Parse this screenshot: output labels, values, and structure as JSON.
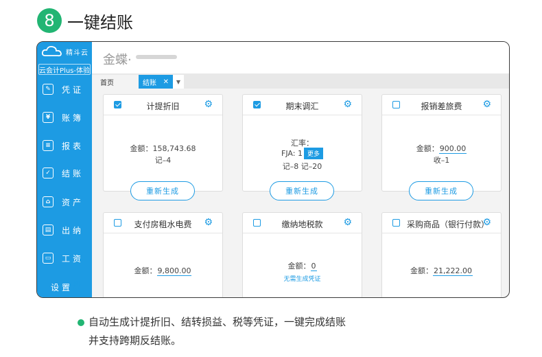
{
  "step": {
    "number": "8",
    "title": "一键结账"
  },
  "sidebar": {
    "logo_text": "精斗云",
    "plan": "云会计Plus-体验",
    "items": [
      {
        "label": "凭证",
        "icon": "voucher-icon",
        "glyph": "✎"
      },
      {
        "label": "账簿",
        "icon": "ledger-icon",
        "glyph": "¥"
      },
      {
        "label": "报表",
        "icon": "report-icon",
        "glyph": "≡"
      },
      {
        "label": "结账",
        "icon": "checkout-icon",
        "glyph": "✓"
      },
      {
        "label": "资产",
        "icon": "asset-icon",
        "glyph": "⌂"
      },
      {
        "label": "出纳",
        "icon": "cashier-icon",
        "glyph": "▤"
      },
      {
        "label": "工资",
        "icon": "salary-icon",
        "glyph": "▭"
      },
      {
        "label": "设置",
        "icon": "gear-icon",
        "glyph": "⚙"
      }
    ]
  },
  "topbar": {
    "brand": "金蝶·"
  },
  "tabs": {
    "home": "首页",
    "active": "结账",
    "close": "✕",
    "dropdown": "▼"
  },
  "cards": [
    {
      "title": "计提折旧",
      "checked": true,
      "lines": [
        "金额：158,743.68",
        "记–4"
      ],
      "button": "重新生成"
    },
    {
      "title": "期末调汇",
      "checked": true,
      "rate_label": "汇率：",
      "rate_value": "FJA: 1",
      "more": "更多",
      "vouchers": "记–8 记–20",
      "button": "重新生成"
    },
    {
      "title": "报销差旅费",
      "checked": false,
      "amount_label": "金额：",
      "amount": "900.00",
      "voucher": "收–1",
      "button": "重新生成"
    },
    {
      "title": "支付房租水电费",
      "checked": false,
      "amount_label": "金额：",
      "amount": "9,800.00"
    },
    {
      "title": "缴纳地税款",
      "checked": false,
      "amount_label": "金额：",
      "amount": "0",
      "note": "无需生成凭证"
    },
    {
      "title": "采购商品（银行付款）",
      "checked": false,
      "amount_label": "金额：",
      "amount": "21,222.00"
    }
  ],
  "bullet": {
    "line1": "自动生成计提折旧、结转损益、税等凭证，一键完成结账",
    "line2": "并支持跨期反结账。"
  },
  "colors": {
    "accent": "#1d9be3",
    "green": "#22b573"
  }
}
